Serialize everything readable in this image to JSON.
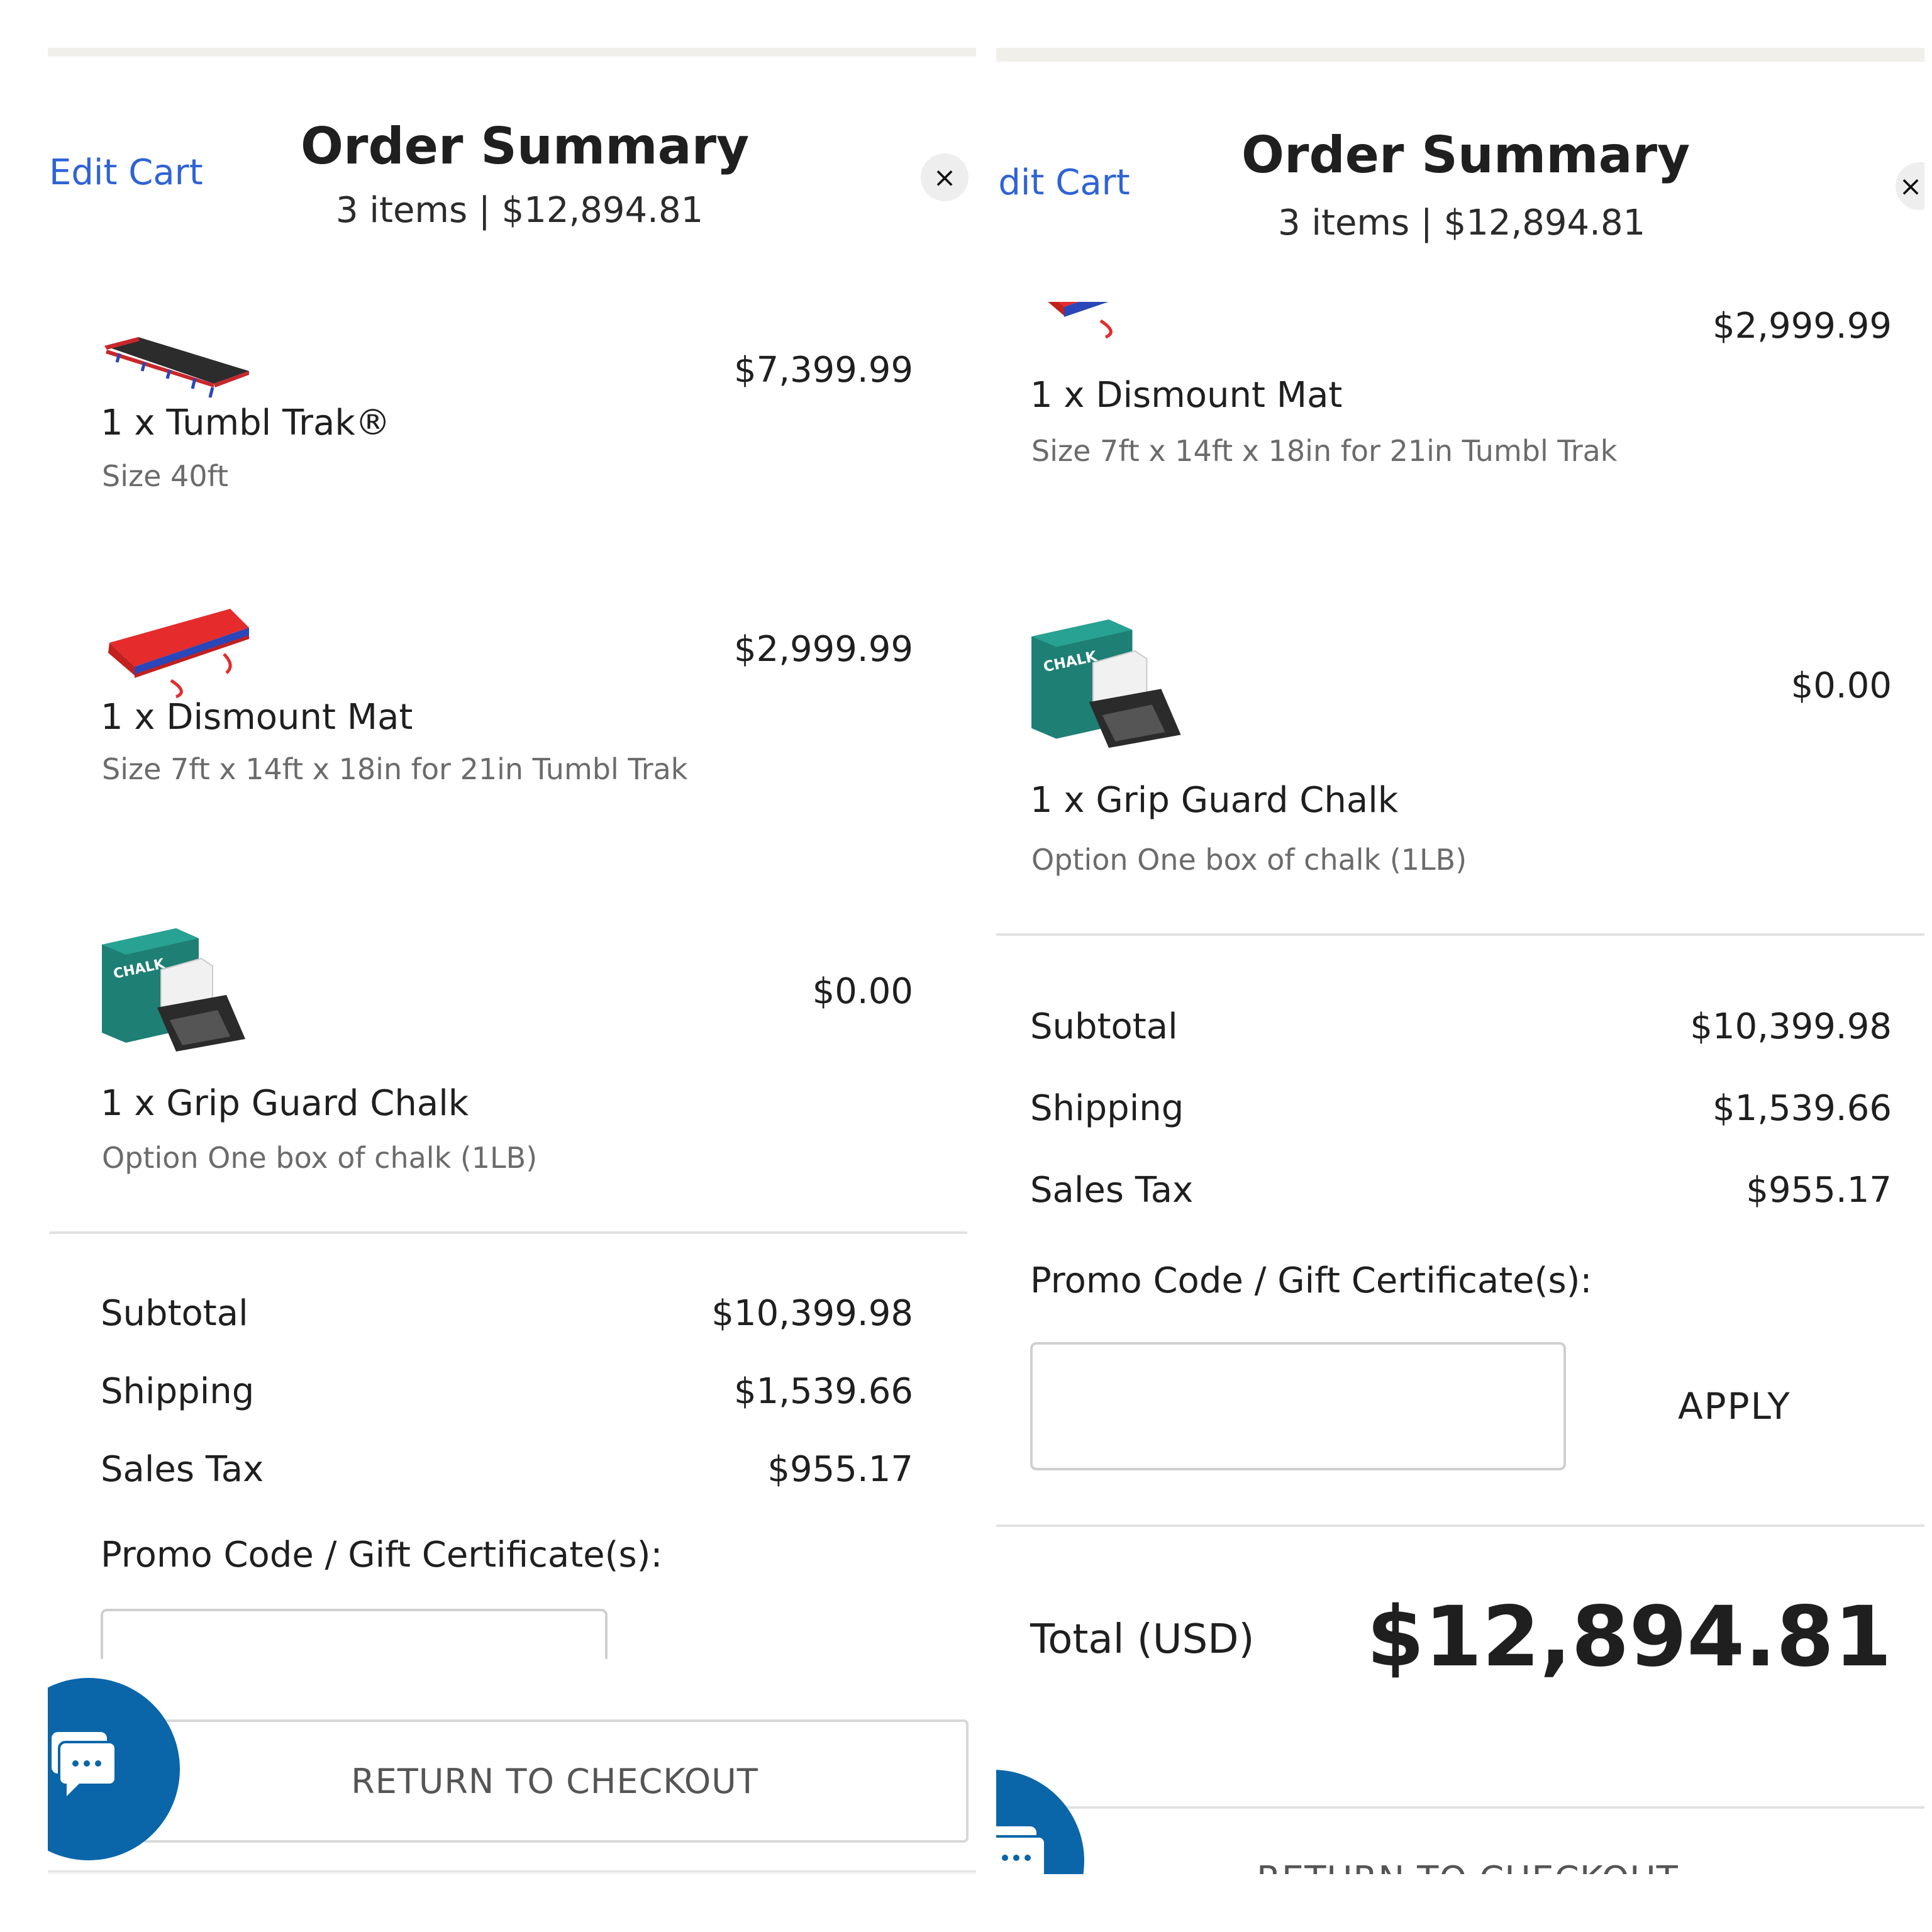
{
  "left": {
    "edit_cart": "Edit Cart",
    "title": "Order Summary",
    "subtitle": "3 items | $12,894.81",
    "close_glyph": "×",
    "items": [
      {
        "name": "1 x Tumbl Trak®",
        "option": "Size 40ft",
        "price": "$7,399.99",
        "icon": "tumbl-trak-image"
      },
      {
        "name": "1 x Dismount Mat",
        "option": "Size 7ft x 14ft x 18in for 21in Tumbl Trak",
        "price": "$2,999.99",
        "icon": "dismount-mat-image"
      },
      {
        "name": "1 x Grip Guard Chalk",
        "option": "Option One box of chalk (1LB)",
        "price": "$0.00",
        "icon": "grip-guard-chalk-image"
      }
    ],
    "summary": {
      "subtotal_label": "Subtotal",
      "subtotal_value": "$10,399.98",
      "shipping_label": "Shipping",
      "shipping_value": "$1,539.66",
      "tax_label": "Sales Tax",
      "tax_value": "$955.17"
    },
    "promo_label": "Promo Code / Gift Certificate(s):",
    "promo_placeholder": "",
    "checkout_label": "RETURN TO CHECKOUT"
  },
  "right": {
    "edit_cart": "Edit Cart",
    "title": "Order Summary",
    "subtitle": "3 items | $12,894.81",
    "close_glyph": "×",
    "items": [
      {
        "name": "1 x Dismount Mat",
        "option": "Size 7ft x 14ft x 18in for 21in Tumbl Trak",
        "price": "$2,999.99",
        "icon": "dismount-mat-image"
      },
      {
        "name": "1 x Grip Guard Chalk",
        "option": "Option One box of chalk (1LB)",
        "price": "$0.00",
        "icon": "grip-guard-chalk-image"
      }
    ],
    "summary": {
      "subtotal_label": "Subtotal",
      "subtotal_value": "$10,399.98",
      "shipping_label": "Shipping",
      "shipping_value": "$1,539.66",
      "tax_label": "Sales Tax",
      "tax_value": "$955.17"
    },
    "promo_label": "Promo Code / Gift Certificate(s):",
    "promo_placeholder": "",
    "apply_label": "APPLY",
    "total_label": "Total (USD)",
    "total_value": "$12,894.81",
    "checkout_label": "RETURN TO CHECKOUT"
  },
  "colors": {
    "link": "#2f63d6",
    "chat_bubble": "#0a66a8",
    "mat_red": "#e52b2b",
    "mat_blue": "#2a46b8",
    "chalk_teal": "#1e7f74"
  }
}
